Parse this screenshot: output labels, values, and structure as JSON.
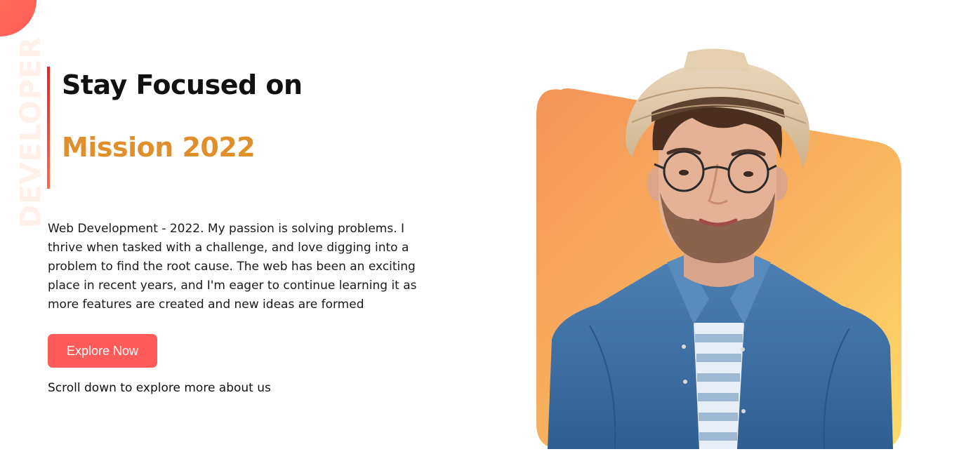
{
  "side_word": "DEVELOPER",
  "headline": {
    "line1": "Stay Focused on",
    "line2": "Mission 2022"
  },
  "intro_text": "Web Development - 2022. My passion is solving problems. I thrive when tasked with a challenge, and love digging into a problem to find the root cause. The web has been an exciting place in recent years, and I'm eager to continue learning it as more features are created and new ideas are formed",
  "cta_label": "Explore Now",
  "scroll_hint": "Scroll down to explore more about us",
  "colors": {
    "accent": "#ff5b5b",
    "highlight": "#e0902a",
    "card_top": "#f4935a",
    "card_bottom": "#fddc6a",
    "shirt": "#3e6fa3"
  },
  "hero_image": {
    "subject": "portrait-photo"
  }
}
